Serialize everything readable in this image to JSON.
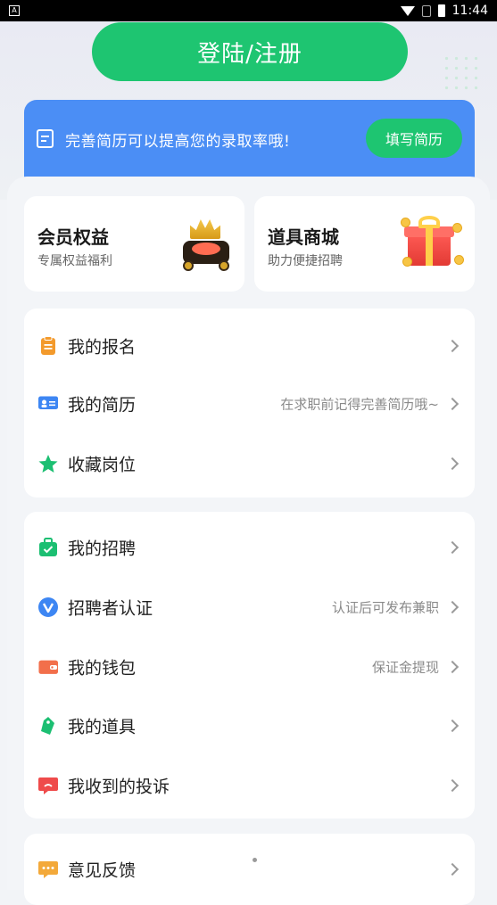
{
  "status_bar": {
    "app_badge": "A",
    "time": "11:44"
  },
  "header": {
    "login_button": "登陆/注册"
  },
  "resume_banner": {
    "text": "完善简历可以提高您的录取率哦!",
    "button": "填写简历"
  },
  "promos": [
    {
      "title": "会员权益",
      "subtitle": "专属权益福利",
      "icon": "crown-icon"
    },
    {
      "title": "道具商城",
      "subtitle": "助力便捷招聘",
      "icon": "gift-icon"
    }
  ],
  "menu_group_1": [
    {
      "label": "我的报名",
      "hint": "",
      "icon": "clipboard-icon",
      "color": "#f39a2c"
    },
    {
      "label": "我的简历",
      "hint": "在求职前记得完善简历哦~",
      "icon": "id-card-icon",
      "color": "#3d86f3"
    },
    {
      "label": "收藏岗位",
      "hint": "",
      "icon": "star-icon",
      "color": "#1cbf72"
    }
  ],
  "menu_group_2": [
    {
      "label": "我的招聘",
      "hint": "",
      "icon": "briefcase-icon",
      "color": "#1cbf72"
    },
    {
      "label": "招聘者认证",
      "hint": "认证后可发布兼职",
      "icon": "verified-icon",
      "color": "#3d86f3"
    },
    {
      "label": "我的钱包",
      "hint": "保证金提现",
      "icon": "wallet-icon",
      "color": "#f26f4b"
    },
    {
      "label": "我的道具",
      "hint": "",
      "icon": "tag-icon",
      "color": "#1cbf72"
    },
    {
      "label": "我收到的投诉",
      "hint": "",
      "icon": "complaint-icon",
      "color": "#ef4b4b"
    }
  ],
  "menu_group_3": [
    {
      "label": "意见反馈",
      "hint": "",
      "icon": "feedback-icon",
      "color": "#f3a93a"
    }
  ]
}
